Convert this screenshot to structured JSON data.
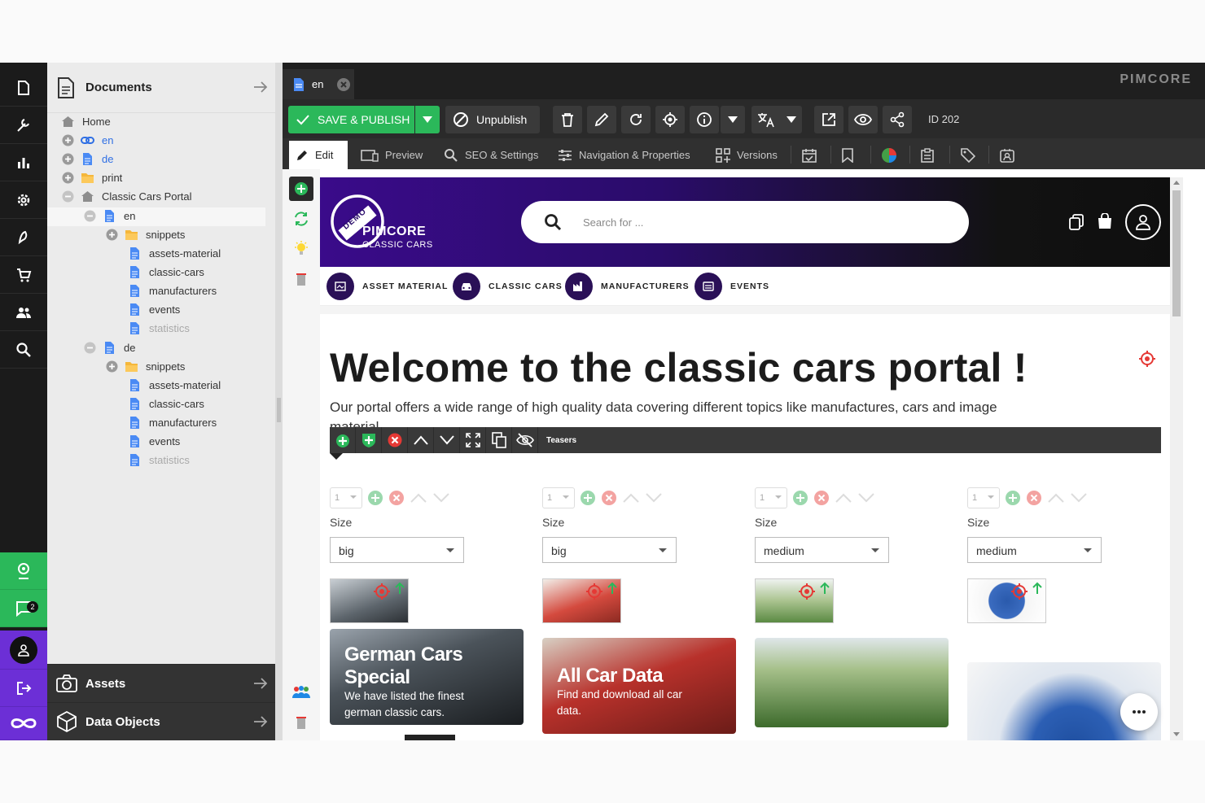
{
  "brand": {
    "logo_text": "PIMCORE"
  },
  "tree": {
    "title": "Documents",
    "nodes": [
      {
        "label": "Home"
      },
      {
        "label": "en"
      },
      {
        "label": "de"
      },
      {
        "label": "print"
      },
      {
        "label": "Classic Cars Portal"
      },
      {
        "label": "en"
      },
      {
        "label": "snippets"
      },
      {
        "label": "assets-material"
      },
      {
        "label": "classic-cars"
      },
      {
        "label": "manufacturers"
      },
      {
        "label": "events"
      },
      {
        "label": "statistics"
      },
      {
        "label": "de"
      },
      {
        "label": "snippets"
      },
      {
        "label": "assets-material"
      },
      {
        "label": "classic-cars"
      },
      {
        "label": "manufacturers"
      },
      {
        "label": "events"
      },
      {
        "label": "statistics"
      }
    ],
    "assets_label": "Assets",
    "data_objects_label": "Data Objects"
  },
  "rail": {
    "notification_count": "2"
  },
  "tab": {
    "label": "en"
  },
  "toolbar": {
    "save_publish": "SAVE & PUBLISH",
    "unpublish": "Unpublish",
    "id_label": "ID 202"
  },
  "subtabs": {
    "edit": "Edit",
    "preview": "Preview",
    "seo": "SEO & Settings",
    "nav": "Navigation & Properties",
    "versions": "Versions"
  },
  "site": {
    "logo_badge": "DEMO",
    "logo_name": "PIMCORE",
    "logo_sub": "CLASSIC CARS",
    "search_placeholder": "Search for ...",
    "nav": [
      "ASSET MATERIAL",
      "CLASSIC CARS",
      "MANUFACTURERS",
      "EVENTS"
    ],
    "title": "Welcome to the classic cars portal !",
    "intro": "Our portal offers a wide range of high quality data covering different topics like manufactures, cars and image",
    "intro_cont": "material.",
    "areabar_label": "Teasers"
  },
  "teasers": [
    {
      "index": "1",
      "size_label": "Size",
      "size": "big",
      "card_title": "German Cars Special",
      "card_desc": "We have listed the finest german classic cars."
    },
    {
      "index": "1",
      "size_label": "Size",
      "size": "big",
      "card_title": "All Car Data",
      "card_desc": "Find and download all car data."
    },
    {
      "index": "1",
      "size_label": "Size",
      "size": "medium",
      "card_title": "",
      "card_desc": ""
    },
    {
      "index": "1",
      "size_label": "Size",
      "size": "medium",
      "card_title": "",
      "card_desc": ""
    }
  ],
  "colors": {
    "accent_green": "#2bb85a",
    "accent_purple": "#6c2fd6",
    "brand_dark_purple": "#2a1057",
    "target_red": "#e53935"
  }
}
